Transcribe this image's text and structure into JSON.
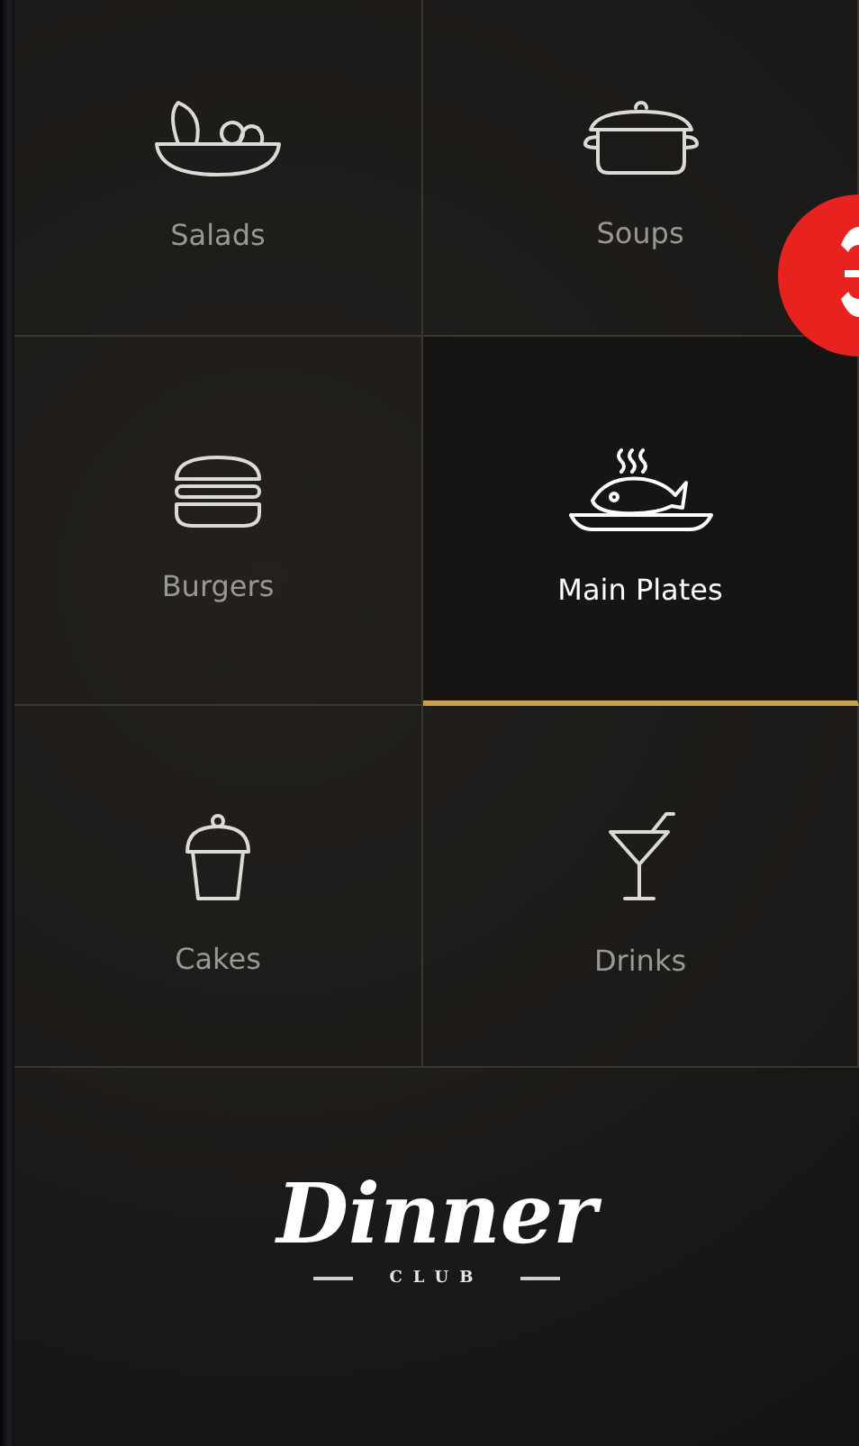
{
  "categories": [
    {
      "label": "Salads",
      "kind": "salad",
      "selected": false
    },
    {
      "label": "Soups",
      "kind": "pot",
      "selected": false
    },
    {
      "label": "Burgers",
      "kind": "burger",
      "selected": false
    },
    {
      "label": "Main Plates",
      "kind": "fish",
      "selected": true
    },
    {
      "label": "Cakes",
      "kind": "cake",
      "selected": false
    },
    {
      "label": "Drinks",
      "kind": "cocktail",
      "selected": false
    }
  ],
  "logo": {
    "title": "Dinner",
    "subtitle": "CLUB"
  }
}
